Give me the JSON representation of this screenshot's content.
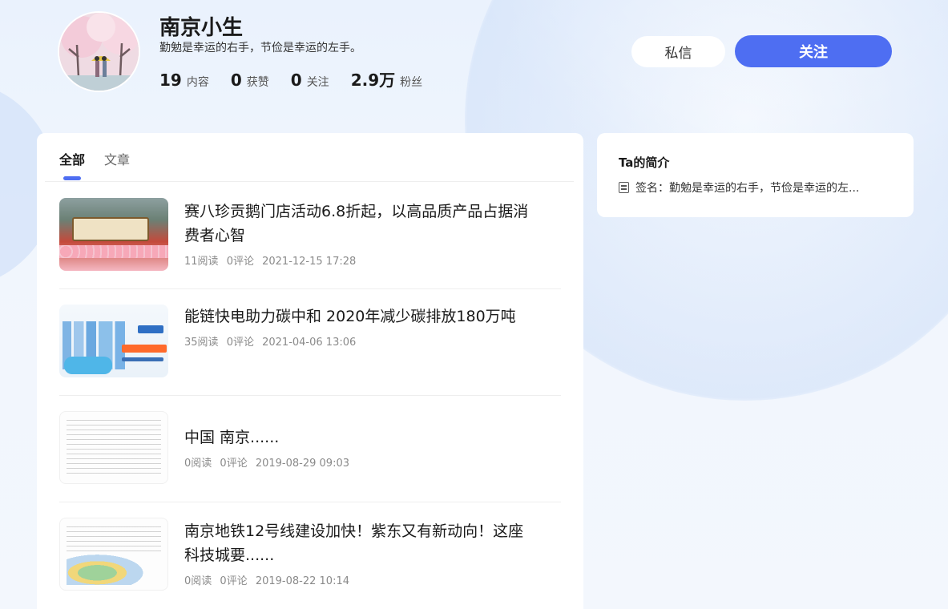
{
  "profile": {
    "name": "南京小生",
    "signature": "勤勉是幸运的右手，节俭是幸运的左手。",
    "stats": [
      {
        "value": "19",
        "label": "内容"
      },
      {
        "value": "0",
        "label": "获赞"
      },
      {
        "value": "0",
        "label": "关注"
      },
      {
        "value": "2.9万",
        "label": "粉丝"
      }
    ]
  },
  "actions": {
    "message_label": "私信",
    "follow_label": "关注"
  },
  "tabs": [
    {
      "label": "全部",
      "active": true
    },
    {
      "label": "文章",
      "active": false
    }
  ],
  "articles": [
    {
      "title": "赛八珍贡鹅门店活动6.8折起，以高品质产品占据消费者心智",
      "reads": "11阅读",
      "comments": "0评论",
      "date": "2021-12-15 17:28"
    },
    {
      "title": "能链快电助力碳中和 2020年减少碳排放180万吨",
      "reads": "35阅读",
      "comments": "0评论",
      "date": "2021-04-06 13:06"
    },
    {
      "title": "中国 南京......",
      "reads": "0阅读",
      "comments": "0评论",
      "date": "2019-08-29 09:03"
    },
    {
      "title": "南京地铁12号线建设加快！紫东又有新动向！这座科技城要......",
      "reads": "0阅读",
      "comments": "0评论",
      "date": "2019-08-22 10:14"
    }
  ],
  "sidebar": {
    "title": "Ta的简介",
    "signature_line": "签名：勤勉是幸运的右手，节俭是幸运的左..."
  },
  "colors": {
    "accent": "#4e6ef2",
    "background": "#eef4fd"
  }
}
